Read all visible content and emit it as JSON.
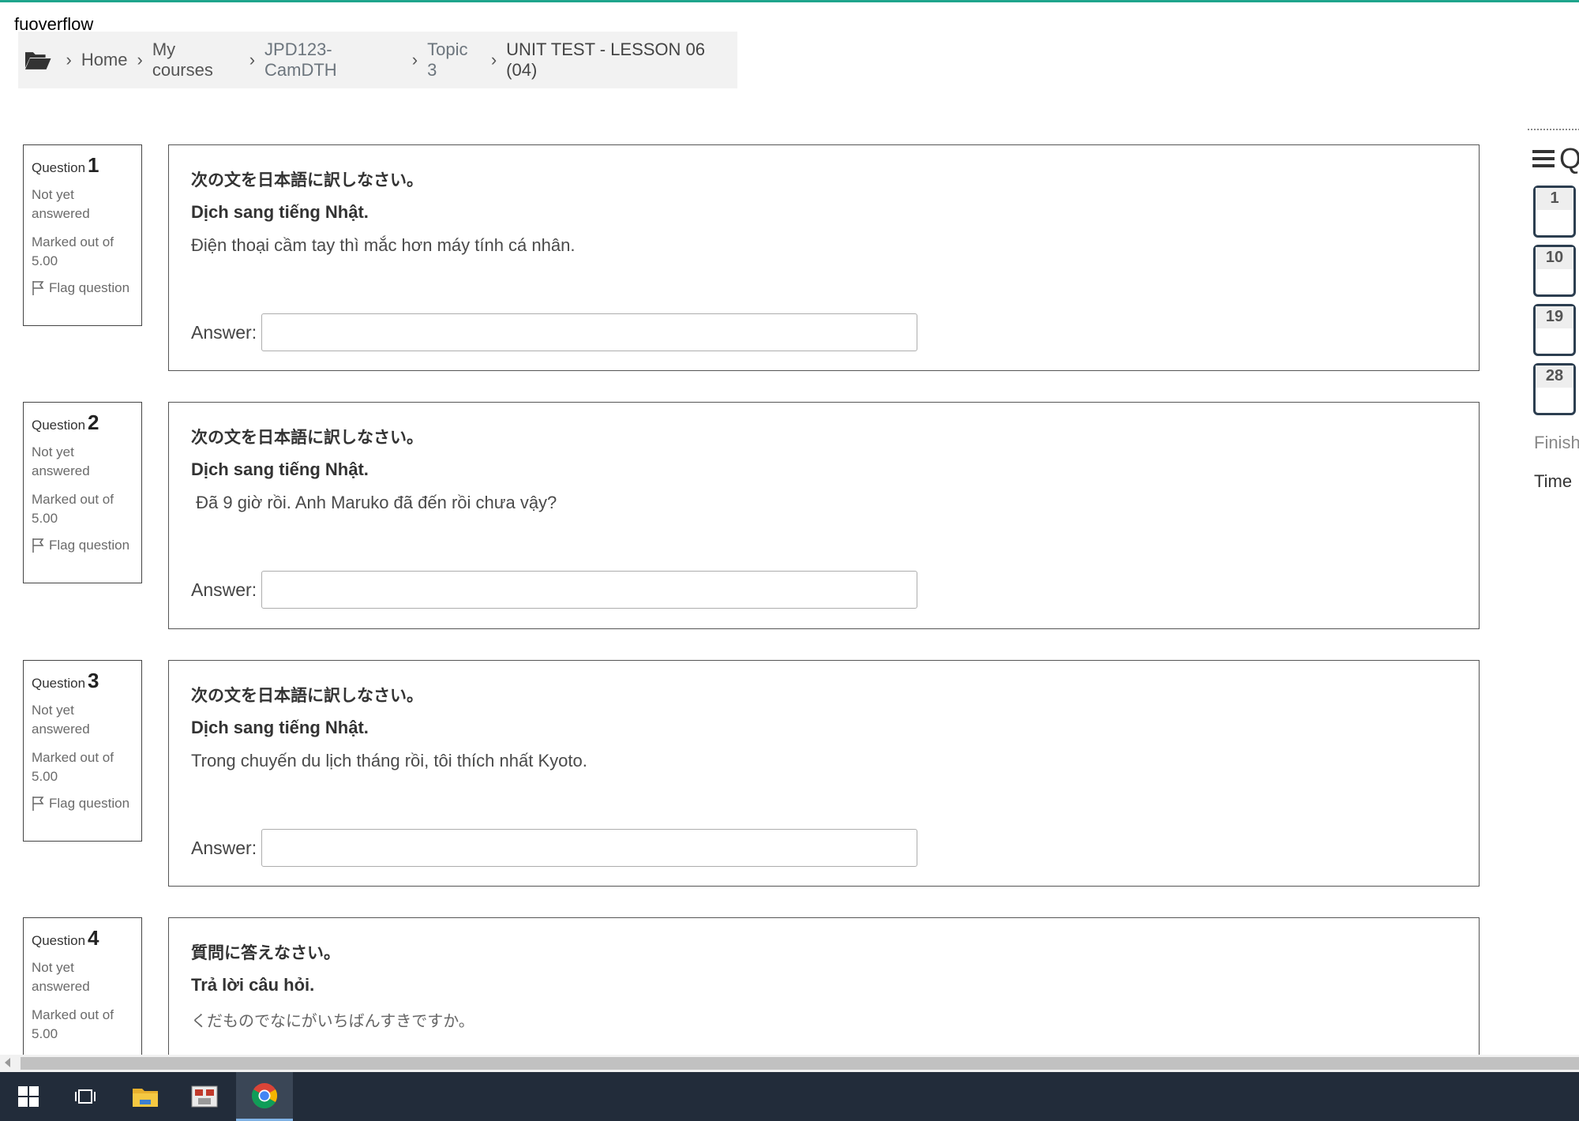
{
  "site": {
    "name": "fuoverflow"
  },
  "breadcrumb": {
    "items": [
      {
        "label": "Home"
      },
      {
        "label": "My courses"
      },
      {
        "label": "JPD123-CamDTH"
      },
      {
        "label": "Topic 3"
      },
      {
        "label": "UNIT TEST - LESSON 06 (04)"
      }
    ],
    "separator": "›"
  },
  "questions": [
    {
      "title": "Question",
      "number": "1",
      "state": "Not yet answered",
      "grade": "Marked out of 5.00",
      "flag": "Flag question",
      "instruction_jp": "次の文を日本語に訳しなさい。",
      "instruction_vi": "Dịch sang tiếng Nhật.",
      "text": "Điện thoại cầm tay thì mắc hơn máy tính cá nhân.",
      "answer_label": "Answer:",
      "answer_value": ""
    },
    {
      "title": "Question",
      "number": "2",
      "state": "Not yet answered",
      "grade": "Marked out of 5.00",
      "flag": "Flag question",
      "instruction_jp": "次の文を日本語に訳しなさい。",
      "instruction_vi": "Dịch sang tiếng Nhật.",
      "text": " Đã 9 giờ rồi. Anh Maruko đã đến rồi chưa vậy?",
      "answer_label": "Answer:",
      "answer_value": ""
    },
    {
      "title": "Question",
      "number": "3",
      "state": "Not yet answered",
      "grade": "Marked out of 5.00",
      "flag": "Flag question",
      "instruction_jp": "次の文を日本語に訳しなさい。",
      "instruction_vi": "Dịch sang tiếng Nhật.",
      "text": "Trong chuyến du lịch tháng rồi, tôi thích nhất Kyoto.",
      "answer_label": "Answer:",
      "answer_value": ""
    },
    {
      "title": "Question",
      "number": "4",
      "state": "Not yet answered",
      "grade": "Marked out of 5.00",
      "instruction_jp": "質問に答えなさい。",
      "instruction_vi": "Trả lời câu hỏi.",
      "text": "くだものでなにがいちばんすきですか。"
    }
  ],
  "quiz_nav": {
    "heading_partial": "Q",
    "buttons": [
      "1",
      "10",
      "19",
      "28"
    ],
    "finish_partial": "Finish",
    "time_partial": "Time"
  },
  "icons": {
    "breadcrumb": "folder-open-icon",
    "flag": "flag-icon",
    "nav": "hamburger-icon",
    "taskbar": [
      "windows-start-icon",
      "task-view-icon",
      "file-explorer-icon",
      "app-icon",
      "chrome-icon"
    ]
  },
  "colors": {
    "accent_line": "#1fa58c",
    "nav_button_border": "#2c3e50",
    "taskbar": "#222c3a"
  }
}
